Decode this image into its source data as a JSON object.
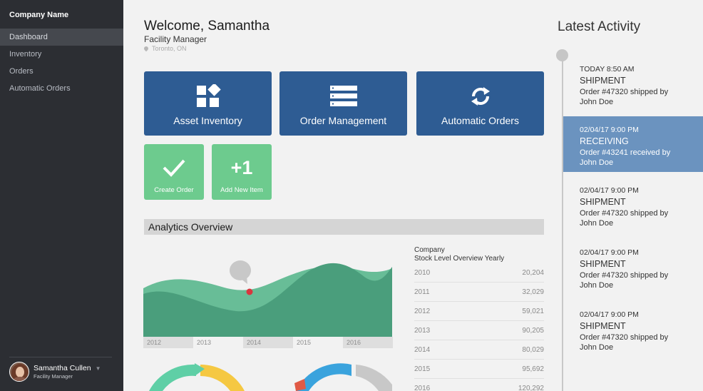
{
  "sidebar": {
    "brand": "Company Name",
    "items": [
      {
        "label": "Dashboard",
        "active": true
      },
      {
        "label": "Inventory",
        "active": false
      },
      {
        "label": "Orders",
        "active": false
      },
      {
        "label": "Automatic Orders",
        "active": false
      }
    ],
    "user": {
      "name": "Samantha Cullen",
      "role": "Facility Manager"
    }
  },
  "header": {
    "welcome": "Welcome, Samantha",
    "role": "Facility Manager",
    "location": "Toronto, ON"
  },
  "tiles": {
    "asset_inventory": "Asset Inventory",
    "order_management": "Order Management",
    "automatic_orders": "Automatic Orders",
    "create_order": "Create Order",
    "add_new_item": "Add New Item",
    "add_new_item_icon_text": "+1"
  },
  "analytics": {
    "title": "Analytics Overview",
    "x_labels": [
      "2012",
      "2013",
      "2014",
      "2015",
      "2016"
    ],
    "stock_title_line1": "Company",
    "stock_title_line2": "Stock Level Overview Yearly",
    "stock": [
      {
        "year": "2010",
        "value": "20,204"
      },
      {
        "year": "2011",
        "value": "32,029"
      },
      {
        "year": "2012",
        "value": "59,021"
      },
      {
        "year": "2013",
        "value": "90,205"
      },
      {
        "year": "2014",
        "value": "80,029"
      },
      {
        "year": "2015",
        "value": "95,692"
      },
      {
        "year": "2016",
        "value": "120,292"
      }
    ]
  },
  "activity": {
    "title": "Latest Activity",
    "items": [
      {
        "time": "TODAY 8:50 AM",
        "type": "SHIPMENT",
        "desc": "Order #47320 shipped by John Doe",
        "highlight": false
      },
      {
        "time": "02/04/17 9:00 PM",
        "type": "RECEIVING",
        "desc": "Order #43241 received by John Doe",
        "highlight": true
      },
      {
        "time": "02/04/17 9:00 PM",
        "type": "SHIPMENT",
        "desc": "Order #47320 shipped by John Doe",
        "highlight": false
      },
      {
        "time": "02/04/17 9:00 PM",
        "type": "SHIPMENT",
        "desc": "Order #47320 shipped by John Doe",
        "highlight": false
      },
      {
        "time": "02/04/17 9:00 PM",
        "type": "SHIPMENT",
        "desc": "Order #47320 shipped by John Doe",
        "highlight": false
      }
    ]
  },
  "colors": {
    "sidebar_bg": "#2c2e33",
    "tile_blue": "#2e5c93",
    "tile_green": "#6dcb8e",
    "area_dark": "#4a9e7c",
    "area_light": "#68bd97",
    "marker_red": "#d9363e",
    "highlight": "#6b93bf"
  },
  "icons": {
    "asset_inventory": "blocks-icon",
    "order_management": "list-icon",
    "automatic_orders": "refresh-icon",
    "create_order": "checkmark-icon",
    "location": "pin-icon"
  }
}
